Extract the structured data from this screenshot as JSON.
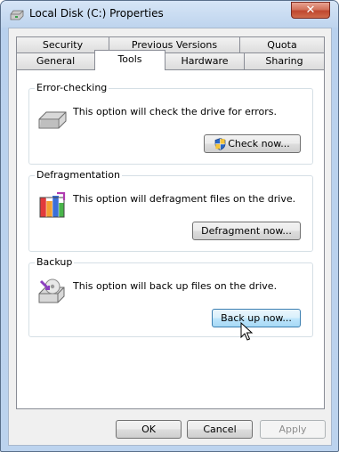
{
  "window": {
    "title": "Local Disk (C:) Properties",
    "close_label": "✕"
  },
  "tabs_row1": [
    {
      "label": "Security"
    },
    {
      "label": "Previous Versions"
    },
    {
      "label": "Quota"
    }
  ],
  "tabs_row2": [
    {
      "label": "General"
    },
    {
      "label": "Tools",
      "active": true
    },
    {
      "label": "Hardware"
    },
    {
      "label": "Sharing"
    }
  ],
  "error_checking": {
    "title": "Error-checking",
    "text": "This option will check the drive for errors.",
    "button": "Check now..."
  },
  "defrag": {
    "title": "Defragmentation",
    "text": "This option will defragment files on the drive.",
    "button": "Defragment now..."
  },
  "backup": {
    "title": "Backup",
    "text": "This option will back up files on the drive.",
    "button": "Back up now..."
  },
  "footer": {
    "ok": "OK",
    "cancel": "Cancel",
    "apply": "Apply"
  },
  "colors": {
    "close": "#c0472f",
    "accent": "#3c7fb1"
  }
}
